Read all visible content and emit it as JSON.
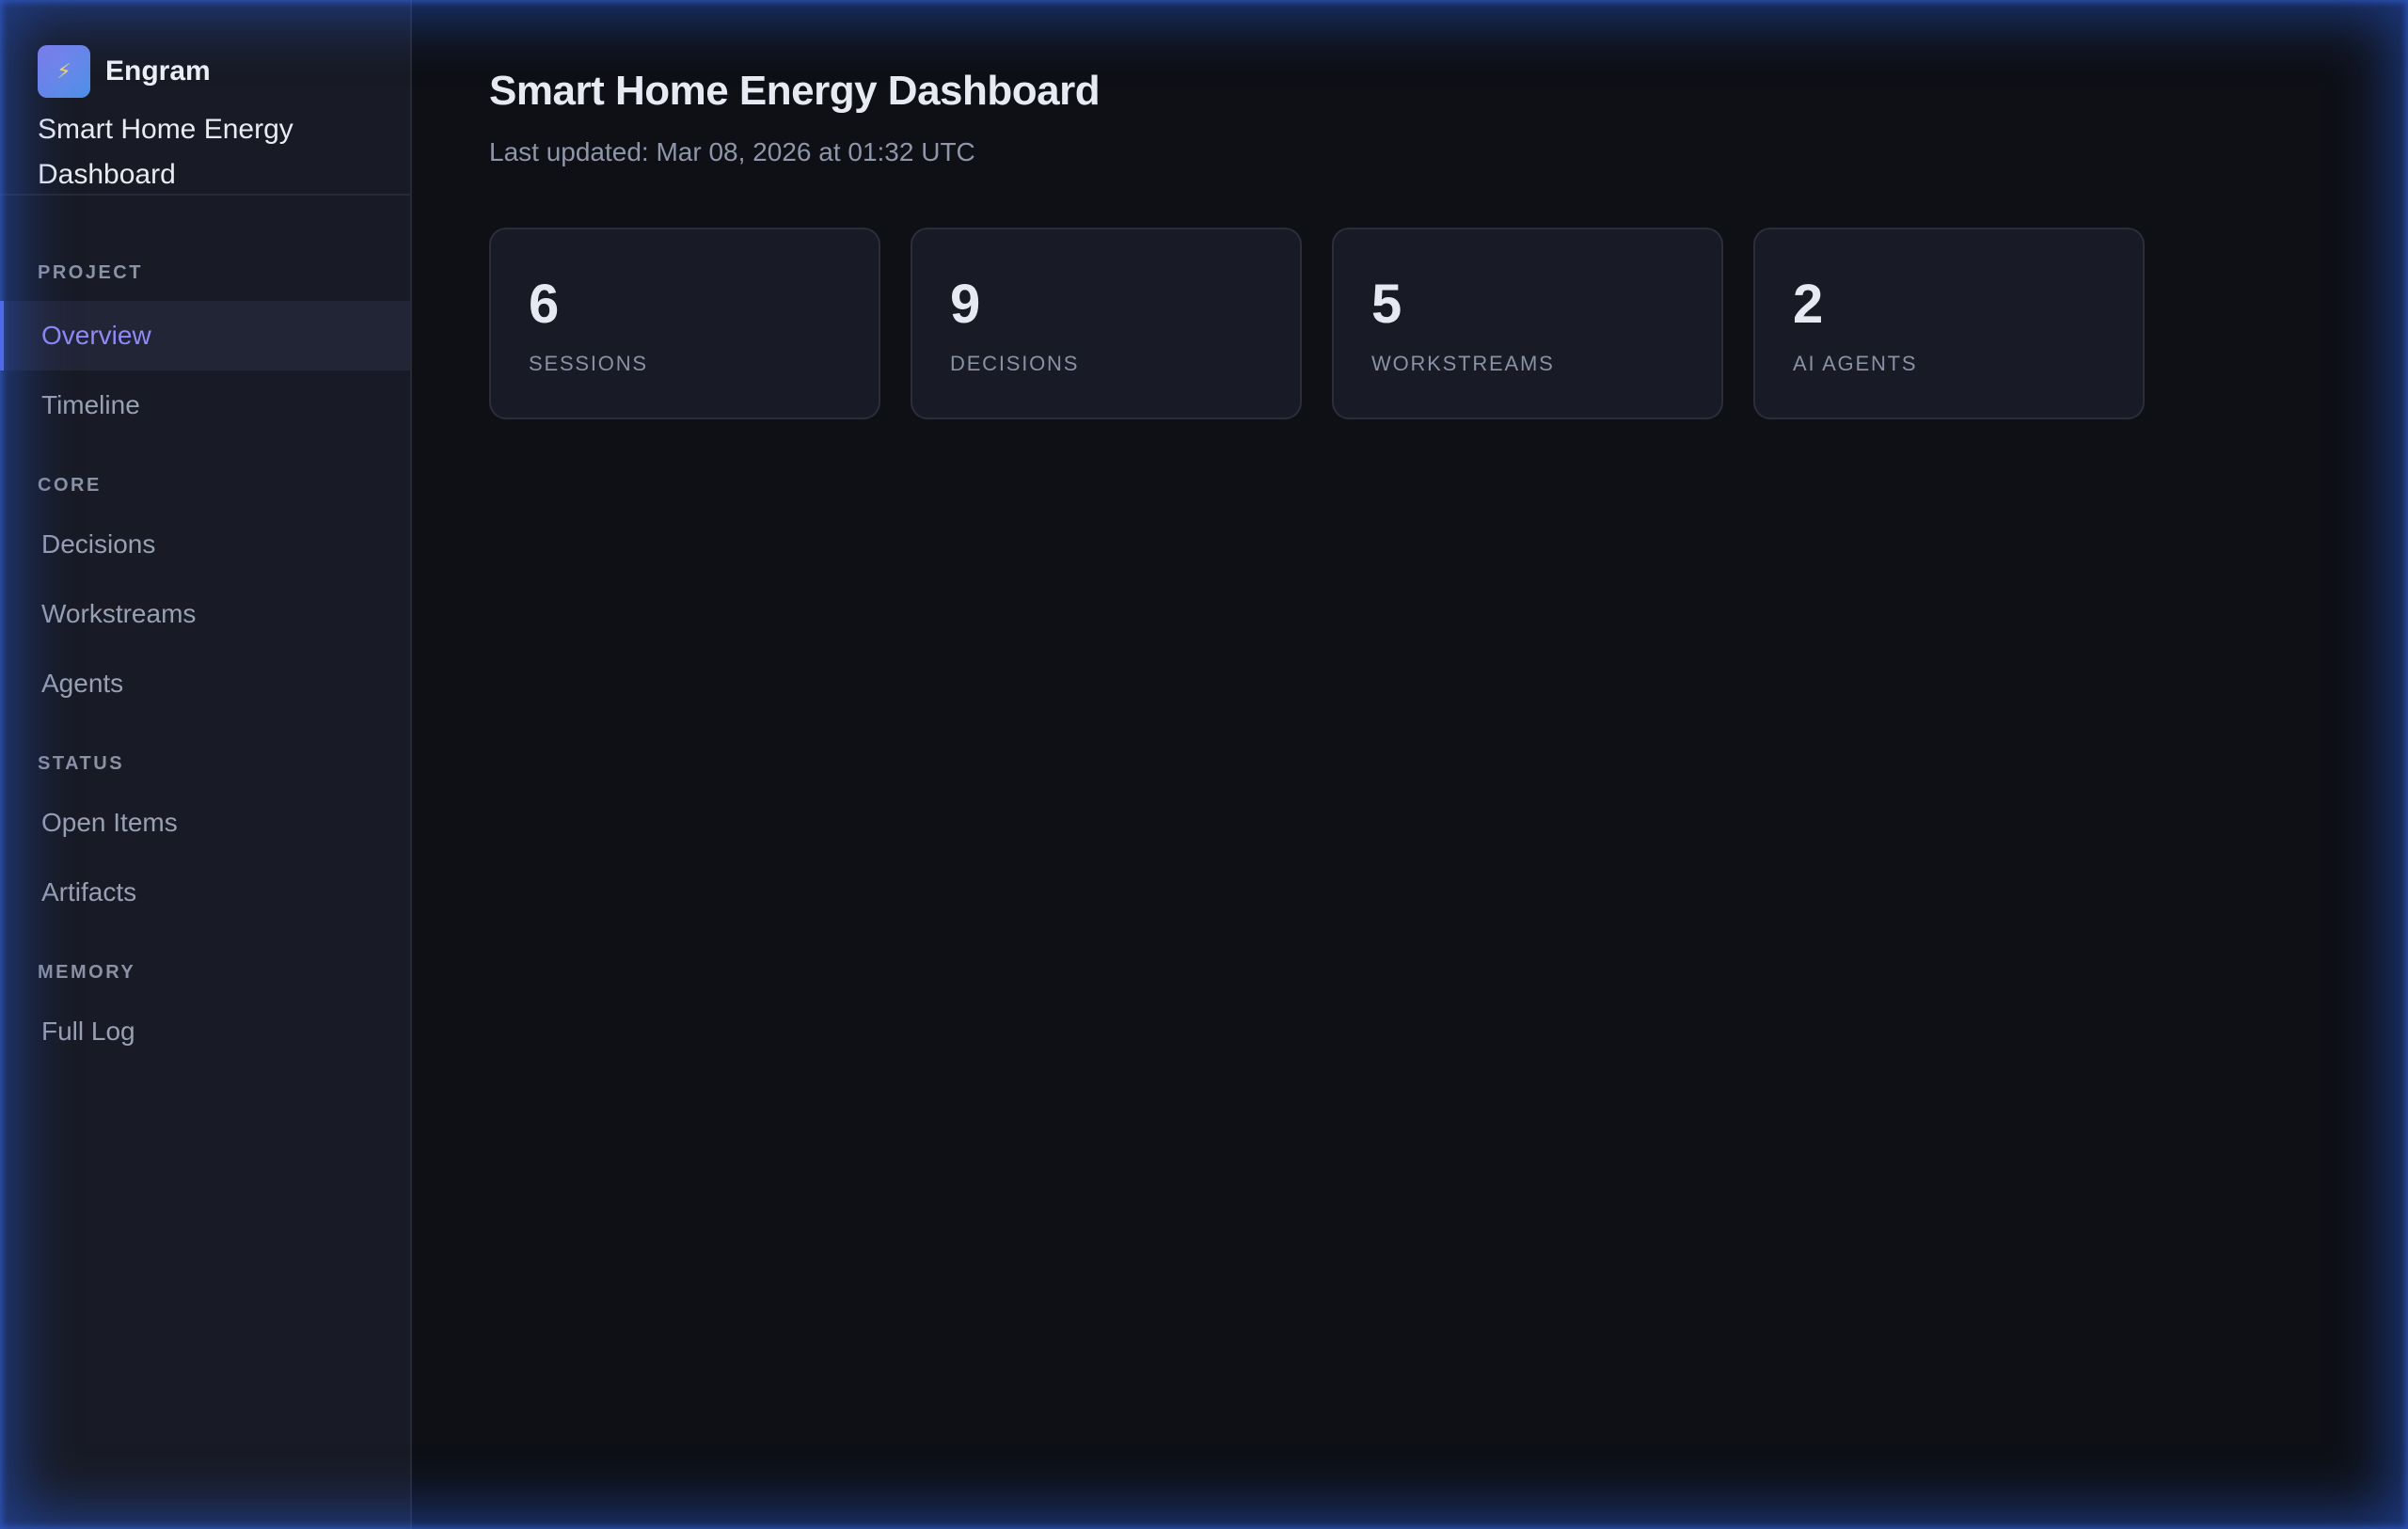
{
  "brand": {
    "name": "Engram",
    "logo_icon": "bolt-icon",
    "project_name": "Smart Home Energy Dashboard"
  },
  "nav": {
    "sections": [
      {
        "label": "PROJECT",
        "items": [
          {
            "label": "Overview",
            "active": true
          },
          {
            "label": "Timeline",
            "active": false
          }
        ]
      },
      {
        "label": "CORE",
        "items": [
          {
            "label": "Decisions",
            "active": false
          },
          {
            "label": "Workstreams",
            "active": false
          },
          {
            "label": "Agents",
            "active": false
          }
        ]
      },
      {
        "label": "STATUS",
        "items": [
          {
            "label": "Open Items",
            "active": false
          },
          {
            "label": "Artifacts",
            "active": false
          }
        ]
      },
      {
        "label": "MEMORY",
        "items": [
          {
            "label": "Full Log",
            "active": false
          }
        ]
      }
    ]
  },
  "main": {
    "title": "Smart Home Energy Dashboard",
    "last_updated": "Last updated: Mar 08, 2026 at 01:32 UTC",
    "stats": [
      {
        "value": "6",
        "label": "SESSIONS"
      },
      {
        "value": "9",
        "label": "DECISIONS"
      },
      {
        "value": "5",
        "label": "WORKSTREAMS"
      },
      {
        "value": "2",
        "label": "AI AGENTS"
      }
    ]
  },
  "colors": {
    "background": "#0e1016",
    "sidebar": "#181b25",
    "accent": "#8f8af7",
    "glow": "#2a5ad2"
  }
}
